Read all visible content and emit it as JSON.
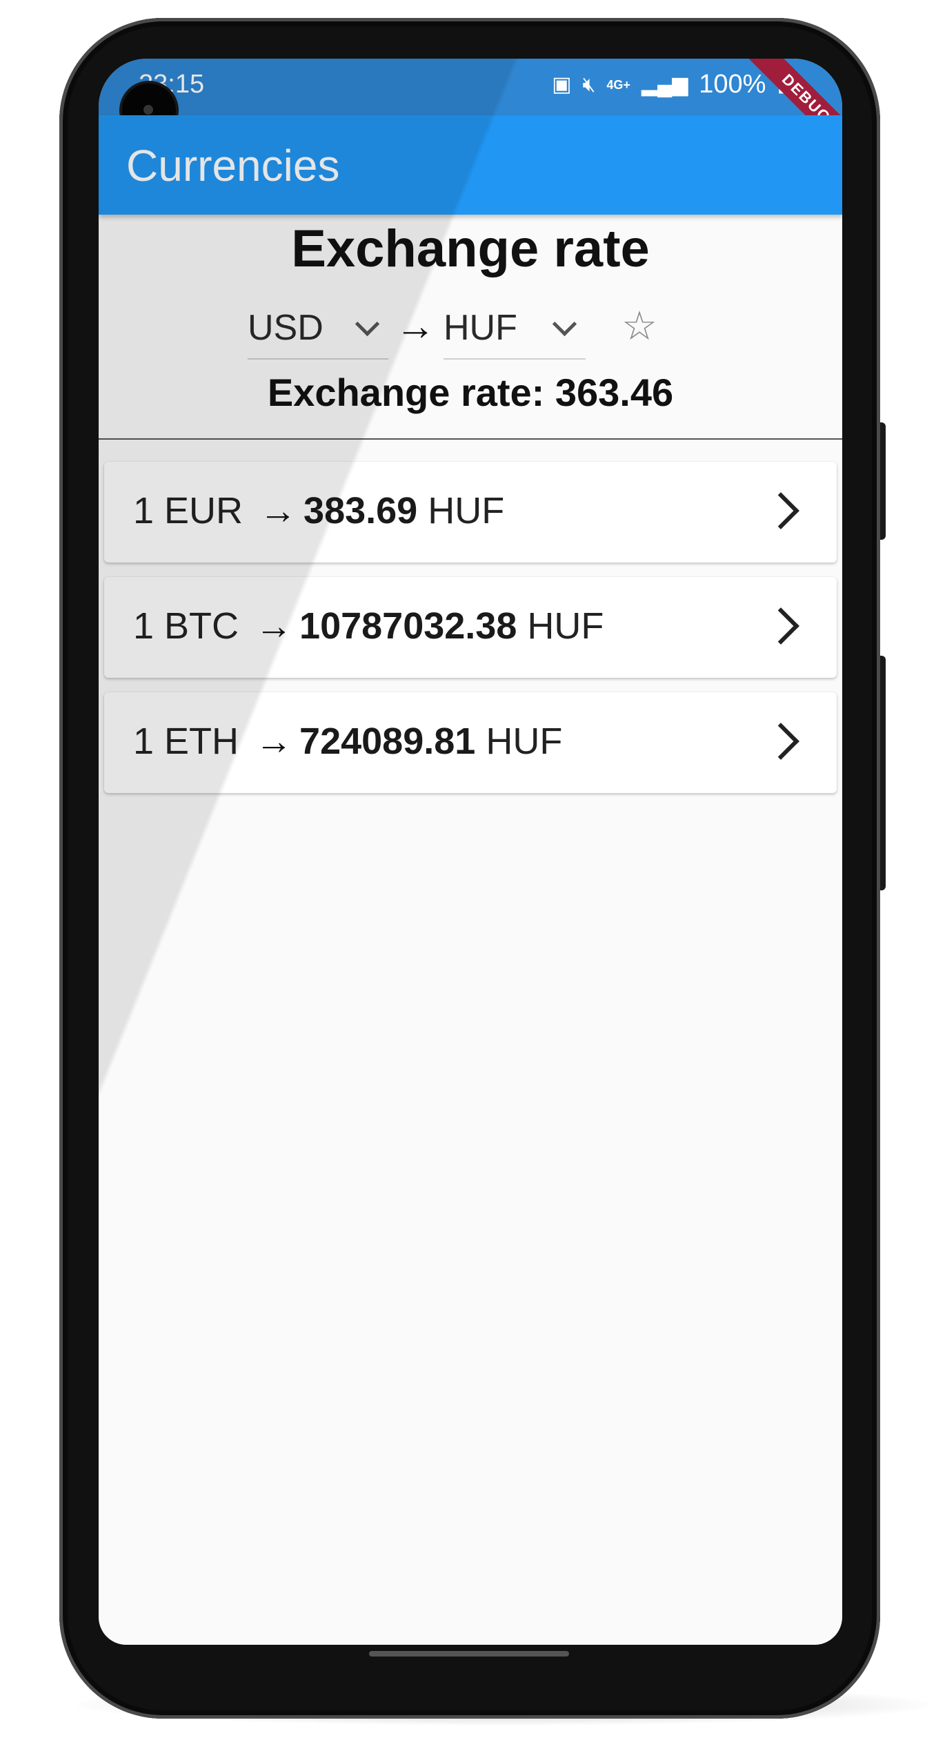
{
  "status_bar": {
    "time": "23:15",
    "network": "4G+",
    "battery_percent": "100%",
    "icons": [
      "battery-saver-icon",
      "mute-icon",
      "network-4g-icon",
      "signal-icon",
      "battery-icon"
    ]
  },
  "debug_banner": "DEBUG",
  "app_bar": {
    "title": "Currencies"
  },
  "main": {
    "heading": "Exchange rate",
    "from_currency": "USD",
    "arrow": "→",
    "to_currency": "HUF",
    "favorite_icon": "star-outline-icon",
    "rate_line": "Exchange rate: 363.46"
  },
  "rates": [
    {
      "prefix": "1 EUR",
      "arrow": "→",
      "amount": "383.69",
      "currency": "HUF"
    },
    {
      "prefix": "1 BTC",
      "arrow": "→",
      "amount": "10787032.38",
      "currency": "HUF"
    },
    {
      "prefix": "1 ETH",
      "arrow": "→",
      "amount": "724089.81",
      "currency": "HUF"
    }
  ],
  "colors": {
    "app_bar": "#2196f3",
    "status_bar": "#2f86d2",
    "background": "#fafafa",
    "debug_ribbon": "#a01e3c"
  }
}
